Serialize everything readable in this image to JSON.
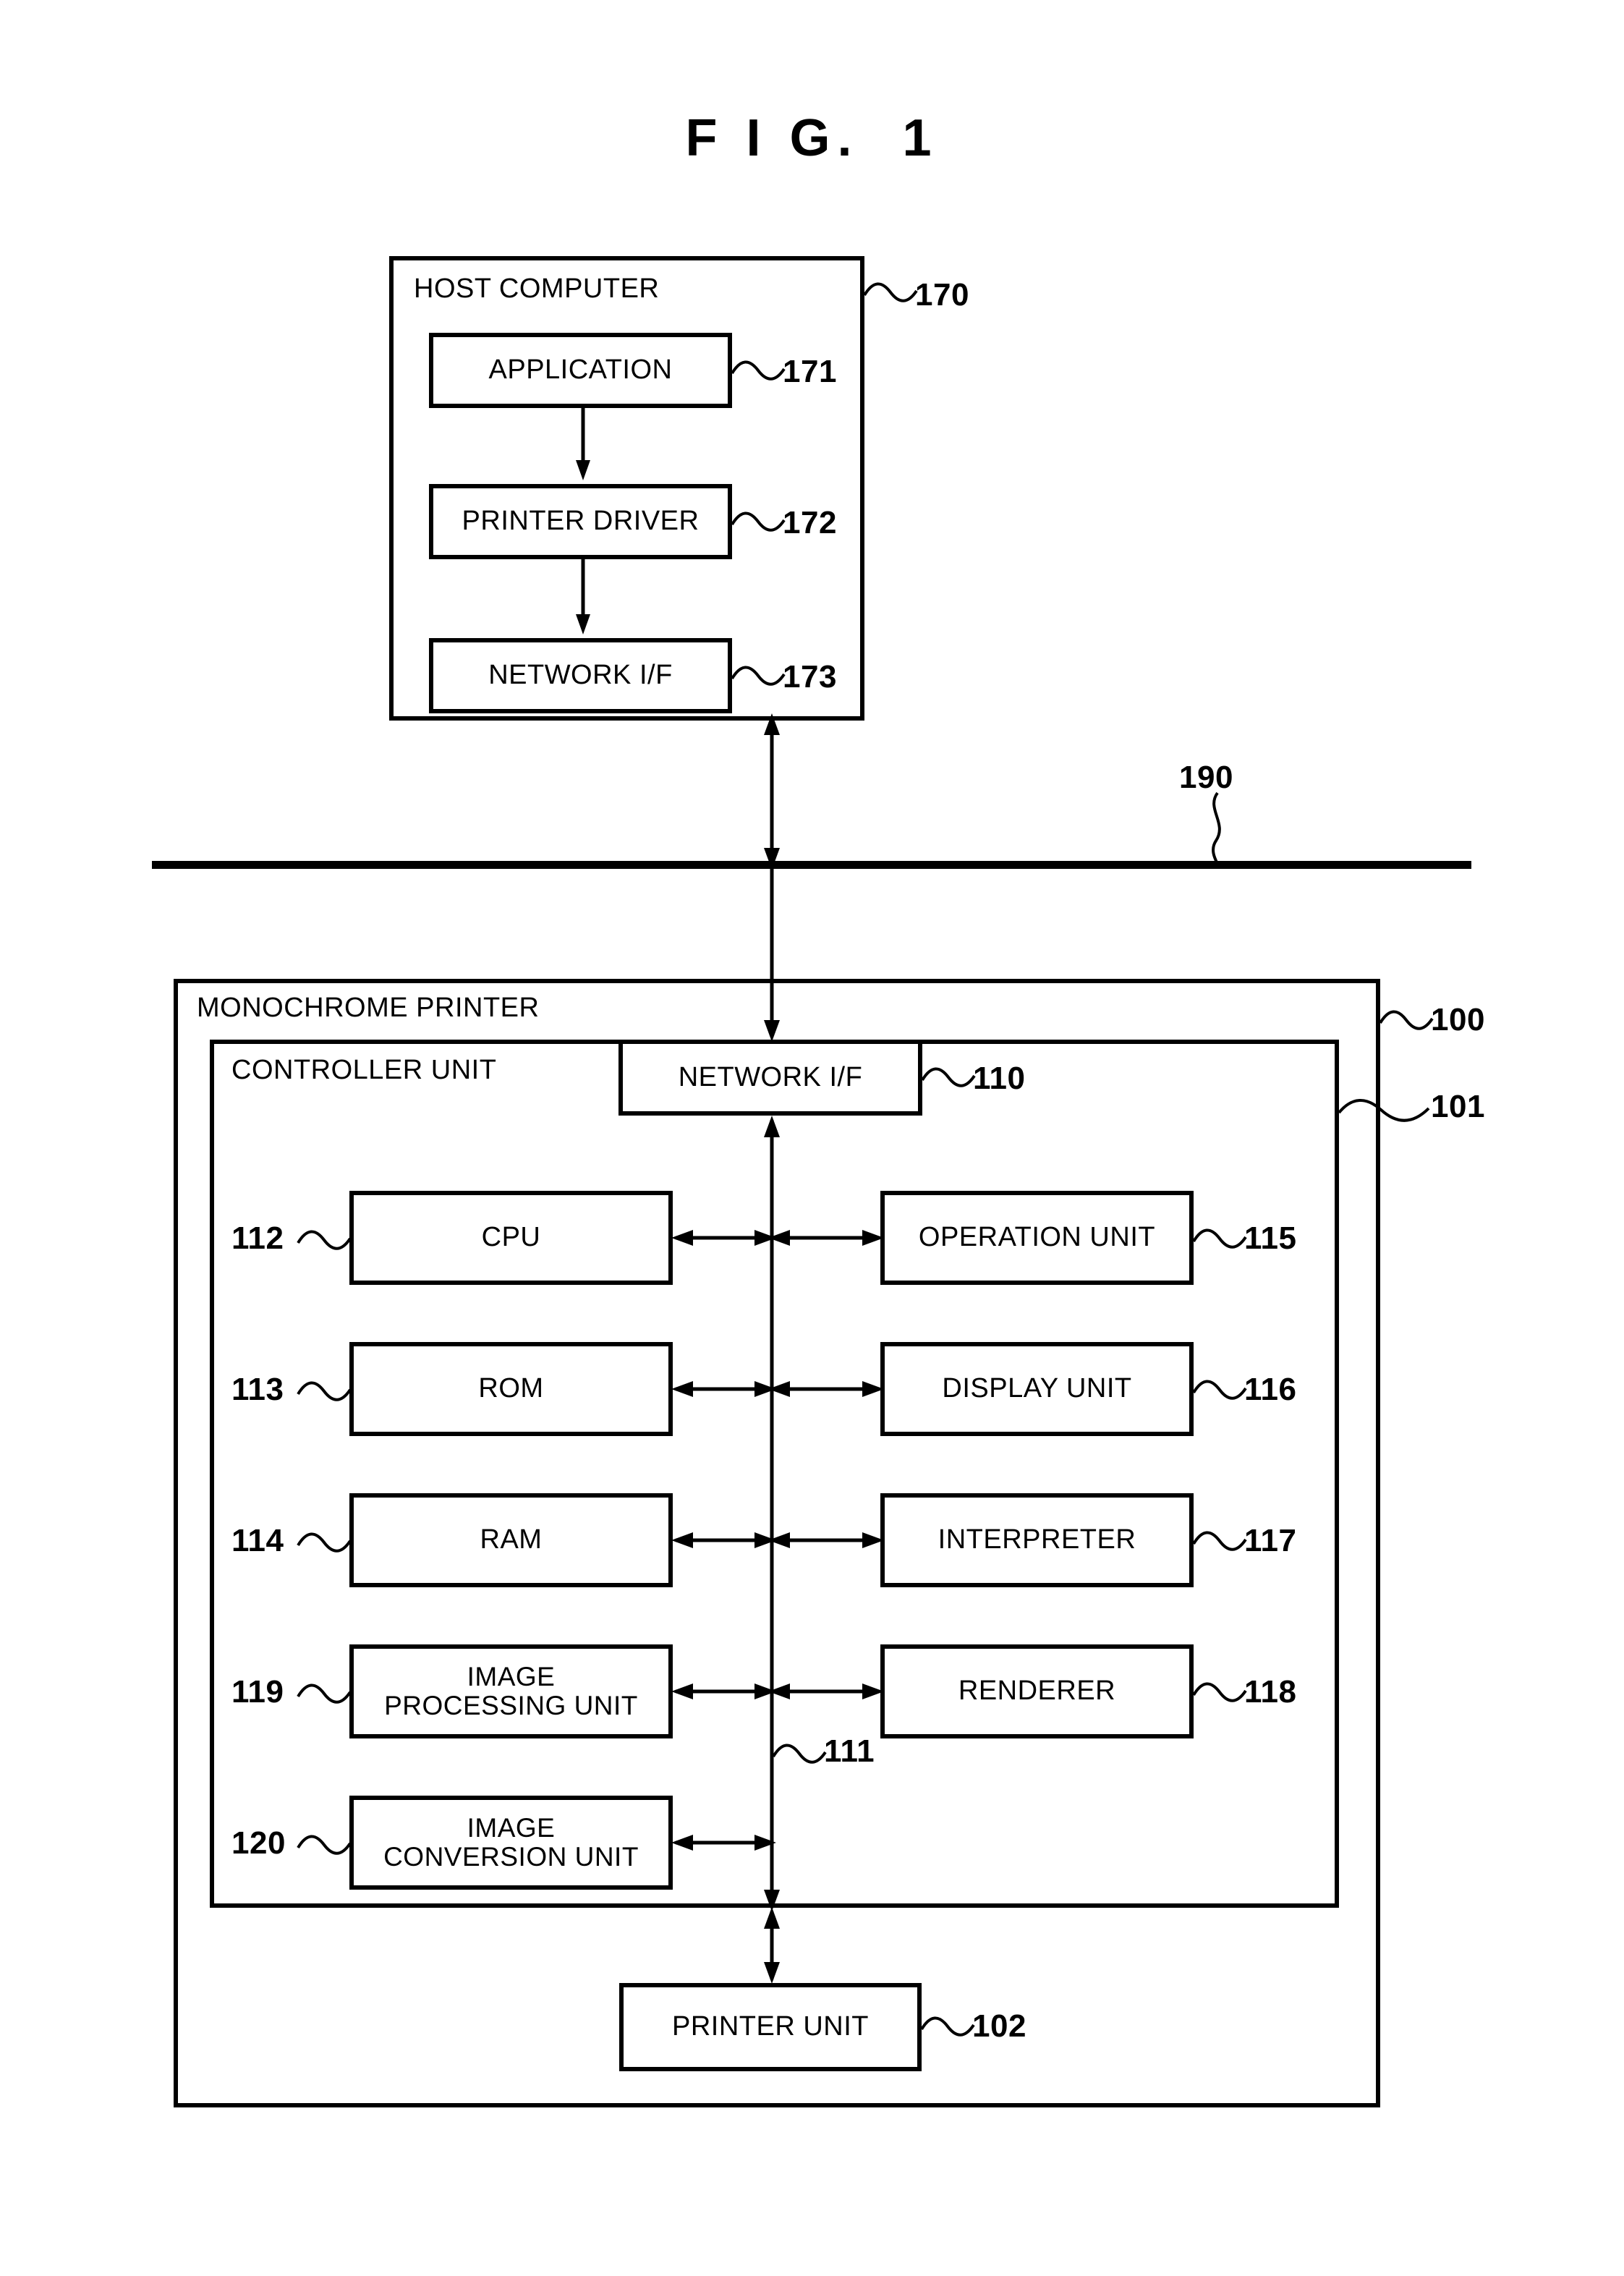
{
  "figure": {
    "title": "F I G.  1"
  },
  "host": {
    "label": "HOST COMPUTER",
    "ref": "170",
    "blocks": [
      {
        "label": "APPLICATION",
        "ref": "171"
      },
      {
        "label": "PRINTER DRIVER",
        "ref": "172"
      },
      {
        "label": "NETWORK I/F",
        "ref": "173"
      }
    ]
  },
  "network": {
    "ref": "190"
  },
  "printer": {
    "label": "MONOCHROME PRINTER",
    "ref": "100",
    "controller": {
      "label": "CONTROLLER UNIT",
      "ref": "101",
      "network_if": {
        "label": "NETWORK I/F",
        "ref": "110"
      },
      "bus_ref": "111",
      "left_column": [
        {
          "label": "CPU",
          "ref": "112",
          "lines": [
            "CPU"
          ]
        },
        {
          "label": "ROM",
          "ref": "113",
          "lines": [
            "ROM"
          ]
        },
        {
          "label": "RAM",
          "ref": "114",
          "lines": [
            "RAM"
          ]
        },
        {
          "label": "IMAGE PROCESSING UNIT",
          "ref": "119",
          "lines": [
            "IMAGE",
            "PROCESSING UNIT"
          ]
        },
        {
          "label": "IMAGE CONVERSION UNIT",
          "ref": "120",
          "lines": [
            "IMAGE",
            "CONVERSION UNIT"
          ]
        }
      ],
      "right_column": [
        {
          "label": "OPERATION UNIT",
          "ref": "115"
        },
        {
          "label": "DISPLAY UNIT",
          "ref": "116"
        },
        {
          "label": "INTERPRETER",
          "ref": "117"
        },
        {
          "label": "RENDERER",
          "ref": "118"
        }
      ]
    },
    "printer_unit": {
      "label": "PRINTER UNIT",
      "ref": "102"
    }
  }
}
